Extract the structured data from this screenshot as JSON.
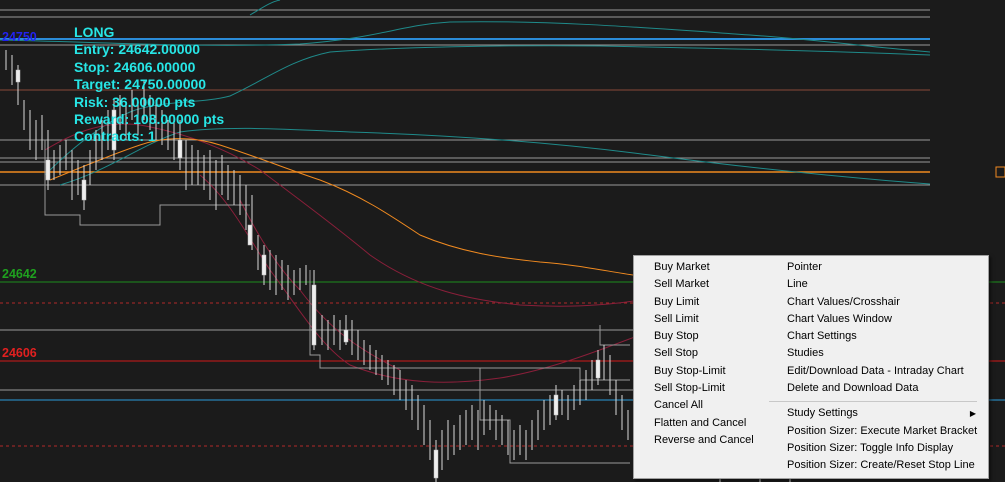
{
  "info_panel": {
    "lines": [
      "LONG",
      "Entry: 24642.00000",
      "Stop: 24606.00000",
      "Target: 24750.00000",
      "Risk: 36.00000 pts",
      "Reward: 108.00000 pts",
      "Contracts: 1"
    ]
  },
  "price_labels": {
    "target": {
      "text": "24750",
      "color": "#2222ee"
    },
    "entry": {
      "text": "24642",
      "color": "#1fa01f"
    },
    "stop": {
      "text": "24606",
      "color": "#e02020"
    }
  },
  "colors": {
    "background": "#1b1b1b",
    "info_text": "#27e6e6",
    "target_line": "#2b8cd8",
    "entry_line": "#1c8c1c",
    "stop_line": "#d01818",
    "orange_line": "#f08a20",
    "teal_band": "#1f8a8a",
    "red_band": "#8a1f3a",
    "menu_bg": "#f0f0f0"
  },
  "context_menu": {
    "left_items": [
      "Buy Market",
      "Sell Market",
      "Buy Limit",
      "Sell Limit",
      "Buy Stop",
      "Sell Stop",
      "Buy Stop-Limit",
      "Sell Stop-Limit",
      "Cancel All",
      "Flatten and Cancel",
      "Reverse and Cancel"
    ],
    "right_items": [
      "Pointer",
      "Line",
      "Chart Values/Crosshair",
      "Chart Values Window",
      "Chart Settings",
      "Studies",
      "Edit/Download Data - Intraday Chart",
      "Delete and Download Data"
    ],
    "right_items_after_separator": [
      "Study Settings",
      "Position Sizer: Execute Market Bracket",
      "Position Sizer: Toggle Info Display",
      "Position Sizer: Create/Reset Stop Line"
    ],
    "submenu_arrow_icon": "triangle-right"
  }
}
